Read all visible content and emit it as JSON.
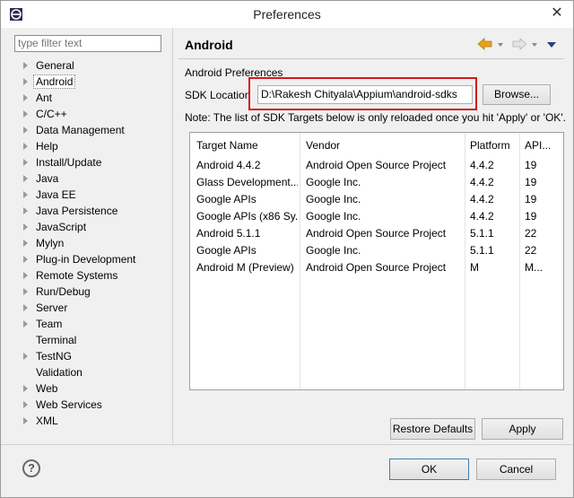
{
  "window": {
    "title": "Preferences"
  },
  "filter": {
    "placeholder": "type filter text"
  },
  "tree": [
    {
      "label": "General",
      "expandable": true
    },
    {
      "label": "Android",
      "expandable": true,
      "selected": true
    },
    {
      "label": "Ant",
      "expandable": true
    },
    {
      "label": "C/C++",
      "expandable": true
    },
    {
      "label": "Data Management",
      "expandable": true
    },
    {
      "label": "Help",
      "expandable": true
    },
    {
      "label": "Install/Update",
      "expandable": true
    },
    {
      "label": "Java",
      "expandable": true
    },
    {
      "label": "Java EE",
      "expandable": true
    },
    {
      "label": "Java Persistence",
      "expandable": true
    },
    {
      "label": "JavaScript",
      "expandable": true
    },
    {
      "label": "Mylyn",
      "expandable": true
    },
    {
      "label": "Plug-in Development",
      "expandable": true
    },
    {
      "label": "Remote Systems",
      "expandable": true
    },
    {
      "label": "Run/Debug",
      "expandable": true
    },
    {
      "label": "Server",
      "expandable": true
    },
    {
      "label": "Team",
      "expandable": true
    },
    {
      "label": "Terminal",
      "expandable": false
    },
    {
      "label": "TestNG",
      "expandable": true
    },
    {
      "label": "Validation",
      "expandable": false
    },
    {
      "label": "Web",
      "expandable": true
    },
    {
      "label": "Web Services",
      "expandable": true
    },
    {
      "label": "XML",
      "expandable": true
    }
  ],
  "page": {
    "title": "Android",
    "section_label": "Android Preferences",
    "sdk_label": "SDK Location",
    "sdk_value": "D:\\Rakesh Chityala\\Appium\\android-sdks",
    "browse_label": "Browse...",
    "note": "Note: The list of SDK Targets below is only reloaded once you hit 'Apply' or 'OK'."
  },
  "table": {
    "columns": [
      "Target Name",
      "Vendor",
      "Platform",
      "API..."
    ],
    "rows": [
      [
        "Android 4.4.2",
        "Android Open Source Project",
        "4.4.2",
        "19"
      ],
      [
        "Glass Development...",
        "Google Inc.",
        "4.4.2",
        "19"
      ],
      [
        "Google APIs",
        "Google Inc.",
        "4.4.2",
        "19"
      ],
      [
        "Google APIs (x86 Sy...",
        "Google Inc.",
        "4.4.2",
        "19"
      ],
      [
        "Android 5.1.1",
        "Android Open Source Project",
        "5.1.1",
        "22"
      ],
      [
        "Google APIs",
        "Google Inc.",
        "5.1.1",
        "22"
      ],
      [
        "Android M (Preview)",
        "Android Open Source Project",
        "M",
        "M..."
      ]
    ]
  },
  "buttons": {
    "restore_defaults": "Restore Defaults",
    "apply": "Apply",
    "ok": "OK",
    "cancel": "Cancel"
  },
  "colors": {
    "highlight_box": "#d4191a",
    "back_arrow": "#e8a31c"
  }
}
